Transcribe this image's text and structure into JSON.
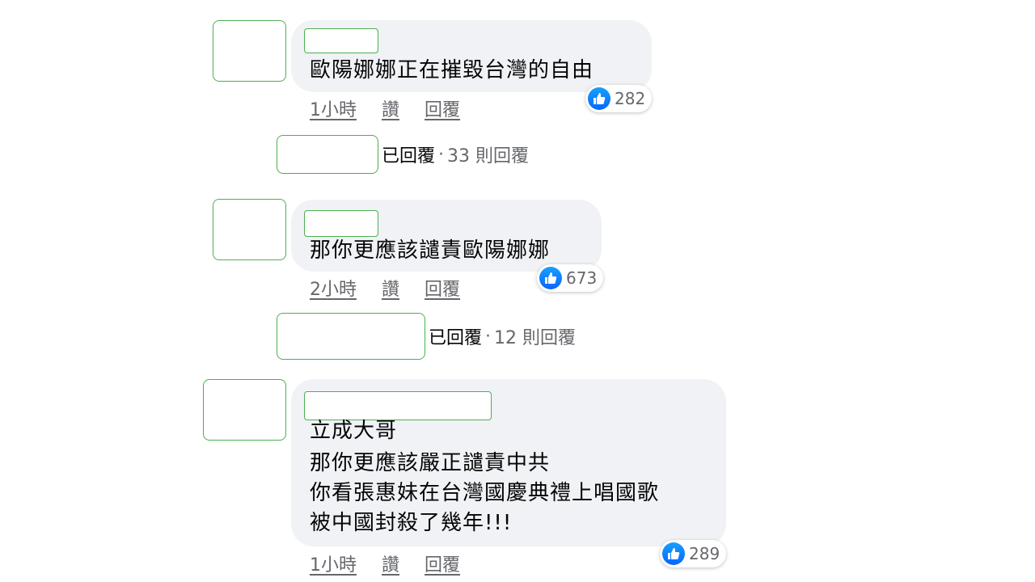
{
  "comments": [
    {
      "text_lines": [
        "歐陽娜娜正在摧毀台灣的自由"
      ],
      "time": "1小時",
      "like_label": "讚",
      "reply_label": "回覆",
      "reactions": "282",
      "replies": {
        "replied_label": "已回覆",
        "separator": "·",
        "count_label": "33 則回覆"
      }
    },
    {
      "text_lines": [
        "那你更應該譴責歐陽娜娜"
      ],
      "time": "2小時",
      "like_label": "讚",
      "reply_label": "回覆",
      "reactions": "673",
      "replies": {
        "replied_label": "已回覆",
        "separator": "·",
        "count_label": "12 則回覆"
      }
    },
    {
      "text_lines": [
        "立成大哥",
        "那你更應該嚴正譴責中共",
        "你看張惠妹在台灣國慶典禮上唱國歌",
        "被中國封殺了幾年!!!"
      ],
      "time": "1小時",
      "like_label": "讚",
      "reply_label": "回覆",
      "reactions": "289"
    }
  ],
  "icons": {
    "reaction": "like-thumbs-up-icon"
  },
  "colors": {
    "bubble": "#f0f2f5",
    "like_blue": "#0866ff",
    "redaction_border": "#4caf50"
  }
}
